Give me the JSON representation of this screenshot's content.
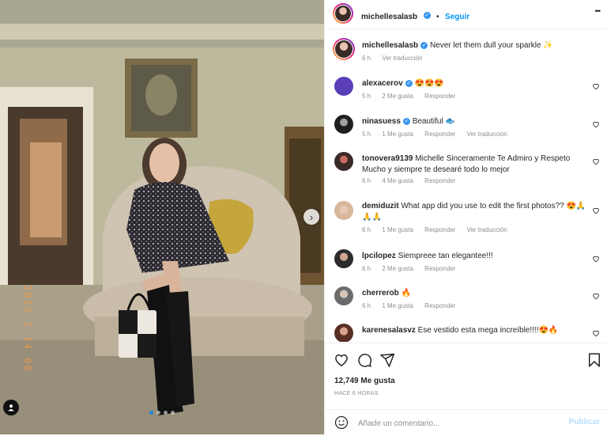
{
  "header": {
    "username": "michellesalasb",
    "separator": "•",
    "follow_label": "Seguir",
    "more_label": "•••"
  },
  "caption": {
    "username": "michellesalasb",
    "text": "Never let them dull your sparkle ✨",
    "time": "6 h",
    "translate": "Ver traducción"
  },
  "comments": [
    {
      "username": "alexacerov",
      "verified": true,
      "text": "😍😍😍",
      "time": "5 h",
      "likes": "2 Me gusta",
      "reply": "Responder",
      "translate": ""
    },
    {
      "username": "ninasuess",
      "verified": true,
      "text": "Beautiful 🐟",
      "time": "5 h",
      "likes": "1 Me gusta",
      "reply": "Responder",
      "translate": "Ver traducción"
    },
    {
      "username": "tonovera9139",
      "verified": false,
      "text": "Michelle Sinceramente Te Admiro y Respeto Mucho y siempre te desearé todo lo mejor",
      "time": "6 h",
      "likes": "4 Me gusta",
      "reply": "Responder",
      "translate": ""
    },
    {
      "username": "demiduzit",
      "verified": false,
      "text": "What app did you use to edit the first photos?? 😍🙏🙏🙏",
      "time": "6 h",
      "likes": "1 Me gusta",
      "reply": "Responder",
      "translate": "Ver traducción"
    },
    {
      "username": "lpcilopez",
      "verified": false,
      "text": "Siempreee tan elegantee!!!",
      "time": "6 h",
      "likes": "2 Me gusta",
      "reply": "Responder",
      "translate": ""
    },
    {
      "username": "cherrerob",
      "verified": false,
      "text": "🔥",
      "time": "6 h",
      "likes": "1 Me gusta",
      "reply": "Responder",
      "translate": ""
    },
    {
      "username": "karenesalasvz",
      "verified": false,
      "text": "Ese vestido esta mega increíble!!!!😍🔥",
      "time": "",
      "likes": "",
      "reply": "",
      "translate": ""
    }
  ],
  "stats": {
    "likes": "12,749 Me gusta",
    "posted": "HACE 6 HORAS"
  },
  "composer": {
    "placeholder": "Añade un comentario...",
    "publish_label": "Publicar"
  },
  "media": {
    "date_stamp": "2023 1 14 08",
    "carousel_count": 4,
    "carousel_active": 1
  },
  "icons": {
    "like": "heart-icon",
    "comment": "comment-icon",
    "share": "share-icon",
    "save": "bookmark-icon",
    "emoji": "emoji-icon",
    "next": "chevron-right-icon",
    "tag": "user-tag-icon"
  },
  "colors": {
    "accent": "#0095f6",
    "verified": "#3897f0",
    "muted": "#8e8e8e"
  }
}
